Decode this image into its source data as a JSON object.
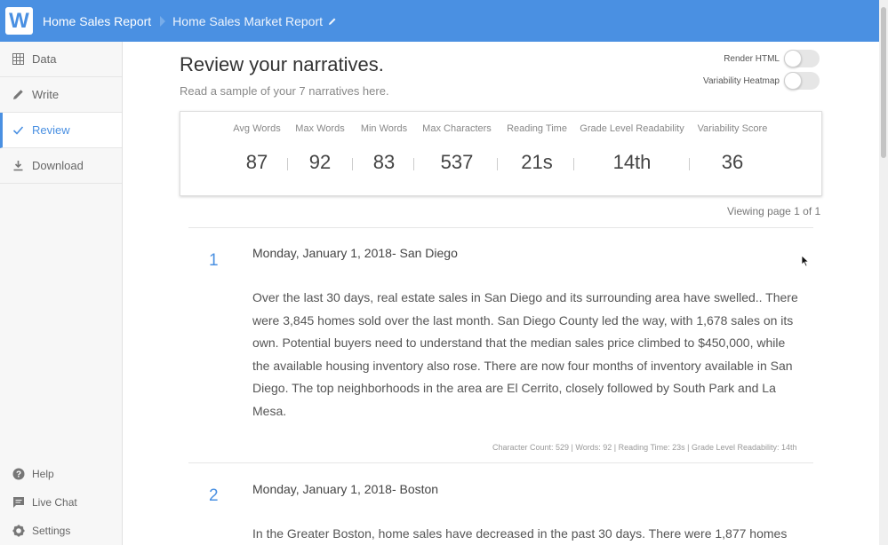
{
  "header": {
    "logo": "W",
    "breadcrumb_project": "Home Sales Report",
    "breadcrumb_doc": "Home Sales Market Report"
  },
  "sidebar": {
    "items": [
      {
        "label": "Data",
        "icon": "grid-icon"
      },
      {
        "label": "Write",
        "icon": "pencil-icon"
      },
      {
        "label": "Review",
        "icon": "check-icon",
        "active": true
      },
      {
        "label": "Download",
        "icon": "download-icon"
      }
    ],
    "bottom": [
      {
        "label": "Help",
        "icon": "help-icon"
      },
      {
        "label": "Live Chat",
        "icon": "chat-icon"
      },
      {
        "label": "Settings",
        "icon": "gear-icon"
      }
    ]
  },
  "main": {
    "title": "Review your narratives.",
    "subtitle": "Read a sample of your 7 narratives here.",
    "toggles": {
      "render_html": "Render HTML",
      "variability_heatmap": "Variability Heatmap"
    },
    "stats": [
      {
        "label": "Avg Words",
        "value": "87"
      },
      {
        "label": "Max Words",
        "value": "92"
      },
      {
        "label": "Min Words",
        "value": "83"
      },
      {
        "label": "Max Characters",
        "value": "537"
      },
      {
        "label": "Reading Time",
        "value": "21s"
      },
      {
        "label": "Grade Level Readability",
        "value": "14th"
      },
      {
        "label": "Variability Score",
        "value": "36"
      }
    ],
    "viewing": "Viewing page 1 of 1",
    "narratives": [
      {
        "num": "1",
        "title": "Monday, January 1, 2018- San Diego",
        "body": "Over the last 30 days, real estate sales in San Diego and its surrounding area have swelled.. There were 3,845 homes sold over the last month. San Diego County led the way, with 1,678 sales on its own. Potential buyers need to understand that the median sales price climbed to $450,000, while the available housing inventory also rose. There are now four months of inventory available in San Diego. The top neighborhoods in the area are El Cerrito, closely followed by South Park and  La Mesa.",
        "meta": "Character Count: 529 | Words: 92 | Reading Time: 23s | Grade Level Readability: 14th"
      },
      {
        "num": "2",
        "title": "Monday, January 1, 2018- Boston",
        "body": "In the Greater Boston, home sales have decreased in the past 30 days. There were 1,877 homes",
        "meta": ""
      }
    ]
  },
  "colors": {
    "accent": "#4a90e2",
    "sidebar_bg": "#f7f7f7"
  }
}
